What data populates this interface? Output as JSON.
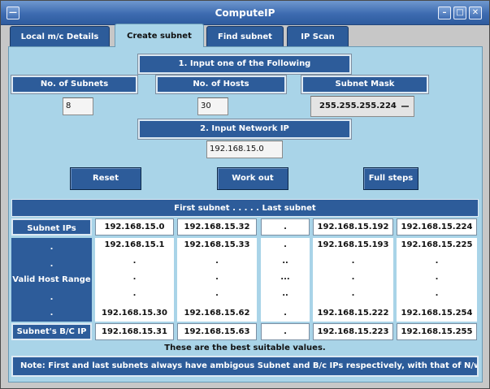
{
  "window": {
    "title": "ComputeIP",
    "menu_glyph": "—",
    "min_glyph": "–",
    "max_glyph": "□",
    "close_glyph": "✕"
  },
  "tabs": [
    {
      "label": "Local m/c Details"
    },
    {
      "label": "Create subnet"
    },
    {
      "label": "Find subnet"
    },
    {
      "label": "IP Scan"
    }
  ],
  "form": {
    "step1": "1.   Input one of the Following",
    "subnets_label": "No. of Subnets",
    "hosts_label": "No. of Hosts",
    "mask_label": "Subnet Mask",
    "subnets_value": "8",
    "hosts_value": "30",
    "mask_value": "255.255.255.224",
    "step2": "2.   Input Network IP",
    "network_ip": "192.168.15.0"
  },
  "buttons": {
    "reset": "Reset",
    "work_out": "Work out",
    "full_steps": "Full steps"
  },
  "table": {
    "header": "First subnet   . . . . .   Last subnet",
    "row_labels": {
      "subnet_ips": "Subnet IPs",
      "range_dots": ".",
      "valid_host_range": "Valid Host Range",
      "bc_ip": "Subnet's B/C IP"
    },
    "subnet_ips": [
      "192.168.15.0",
      "192.168.15.32",
      ".",
      "192.168.15.192",
      "192.168.15.224"
    ],
    "first_hosts": [
      "192.168.15.1",
      "192.168.15.33",
      ".",
      "192.168.15.193",
      "192.168.15.225"
    ],
    "host_dots": [
      ".",
      ".",
      "..",
      ".",
      "."
    ],
    "host_dots_mid": [
      ".",
      ".",
      "...",
      ".",
      "."
    ],
    "host_dots_low": [
      ".",
      ".",
      "..",
      ".",
      "."
    ],
    "host_dots_low2": [
      ".",
      ".",
      ".",
      ".",
      "."
    ],
    "last_hosts": [
      "192.168.15.30",
      "192.168.15.62",
      ".",
      "192.168.15.222",
      "192.168.15.254"
    ],
    "bc_ips": [
      "192.168.15.31",
      "192.168.15.63",
      ".",
      "192.168.15.223",
      "192.168.15.255"
    ]
  },
  "footer": {
    "best": "These are the best suitable values.",
    "note": "Note: First and last subnets always have ambigous Subnet and B/c IPs respectively, with that of N/w IP & B/c"
  }
}
